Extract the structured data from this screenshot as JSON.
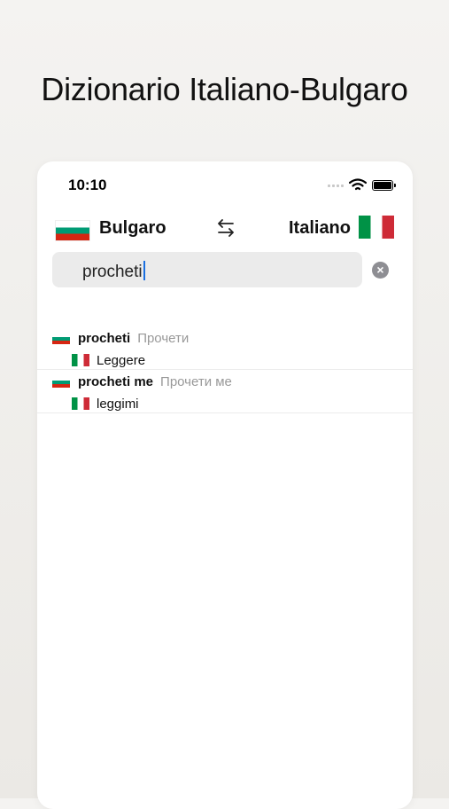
{
  "headline": "Dizionario Italiano-Bulgaro",
  "status_bar": {
    "time": "10:10"
  },
  "languages": {
    "source": "Bulgaro",
    "target": "Italiano"
  },
  "search": {
    "value": "procheti"
  },
  "results": [
    {
      "term": "procheti",
      "cyrillic": "Прочети",
      "translation": "Leggere"
    },
    {
      "term": "procheti me",
      "cyrillic": "Прочети ме",
      "translation": "leggimi"
    }
  ],
  "colors": {
    "accent_caret": "#1a6fe0",
    "bg": "#f0efec"
  },
  "icons": {
    "swap": "swap-arrows-icon",
    "clear": "clear-circle-icon",
    "wifi": "wifi-icon",
    "battery": "battery-icon"
  }
}
